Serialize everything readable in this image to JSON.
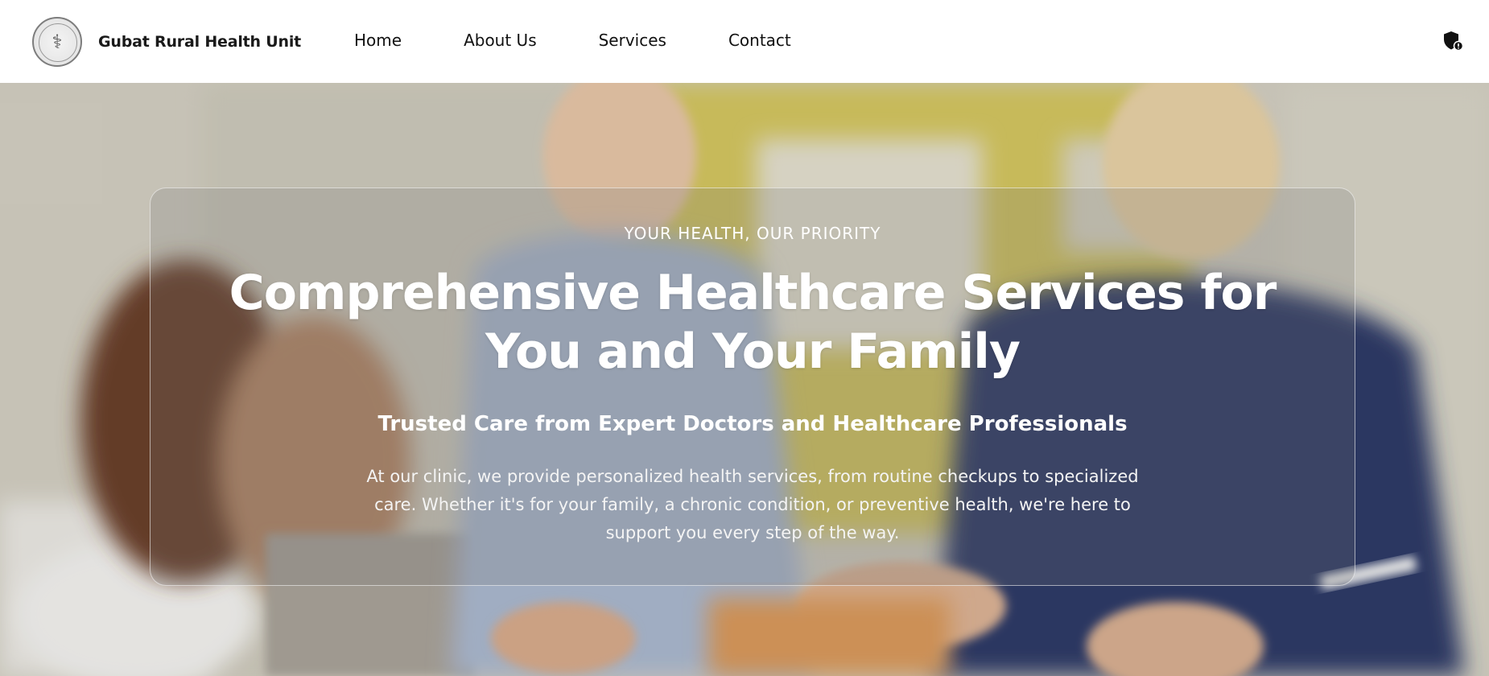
{
  "header": {
    "brand_name": "Gubat Rural Health Unit",
    "logo_icon": "municipal-health-office-seal",
    "nav": [
      {
        "label": "Home"
      },
      {
        "label": "About Us"
      },
      {
        "label": "Services"
      },
      {
        "label": "Contact"
      }
    ],
    "privacy_icon": "shield-icon"
  },
  "hero": {
    "eyebrow": "YOUR HEALTH, OUR PRIORITY",
    "headline": "Comprehensive Healthcare Services for You and Your Family",
    "subheadline": "Trusted Care from Expert Doctors and Healthcare Professionals",
    "description": "At our clinic, we provide personalized health services, from routine checkups to specialized care. Whether it's for your family, a chronic condition, or preventive health, we're here to support you every step of the way.",
    "background_image": "nurses-with-patient-photo"
  },
  "colors": {
    "nav_background": "#ffffff",
    "nav_text": "#111111",
    "hero_text": "#ffffff",
    "glass_overlay": "rgba(120,120,120,0.22)"
  }
}
